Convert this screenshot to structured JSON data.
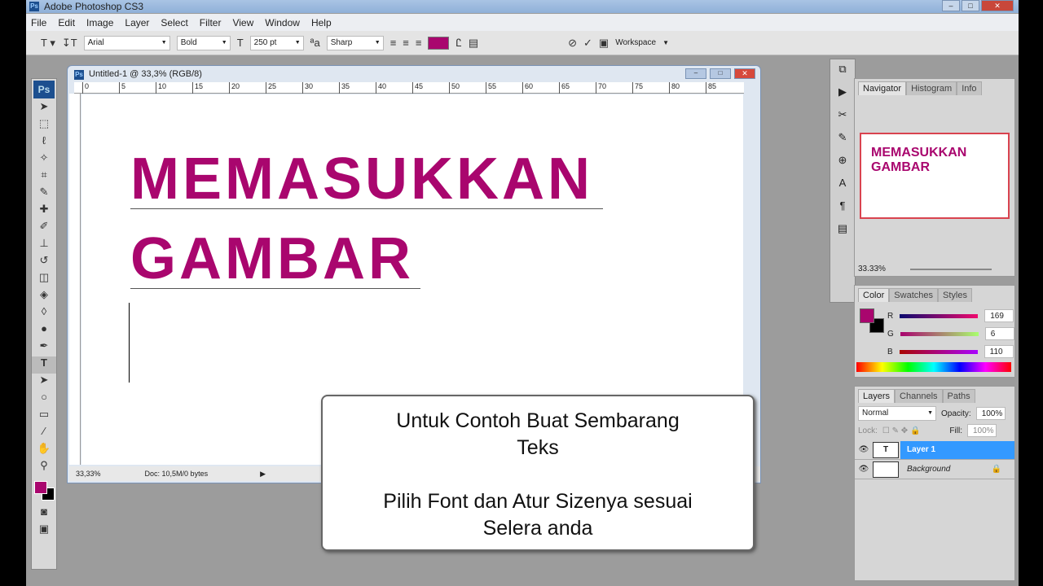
{
  "app": {
    "title": "Adobe Photoshop CS3"
  },
  "menu": [
    "File",
    "Edit",
    "Image",
    "Layer",
    "Select",
    "Filter",
    "View",
    "Window",
    "Help"
  ],
  "options": {
    "font_family": "Arial",
    "font_style": "Bold",
    "font_size": "250 pt",
    "antialias": "Sharp",
    "text_color": "#a9066e",
    "workspace": "Workspace"
  },
  "document": {
    "title": "Untitled-1 @ 33,3% (RGB/8)",
    "ruler_ticks": [
      "0",
      "5",
      "10",
      "15",
      "20",
      "25",
      "30",
      "35",
      "40",
      "45",
      "50",
      "55",
      "60",
      "65",
      "70",
      "75",
      "80",
      "85"
    ],
    "text_line1": "MEMASUKKAN",
    "text_line2": "GAMBAR",
    "zoom": "33,33%",
    "doc_info": "Doc: 10,5M/0 bytes"
  },
  "caption": {
    "line1": "Untuk Contoh Buat Sembarang Teks",
    "line2": "Pilih Font dan Atur Sizenya sesuai Selera anda"
  },
  "navigator": {
    "tabs": [
      "Navigator",
      "Histogram",
      "Info"
    ],
    "preview_text": "MEMASUKKAN GAMBAR",
    "zoom": "33.33%"
  },
  "color": {
    "tabs": [
      "Color",
      "Swatches",
      "Styles"
    ],
    "r_label": "R",
    "g_label": "G",
    "b_label": "B",
    "r": "169",
    "g": "6",
    "b": "110",
    "foreground": "#a9066e",
    "background": "#000000"
  },
  "layers": {
    "tabs": [
      "Layers",
      "Channels",
      "Paths"
    ],
    "blend_mode": "Normal",
    "opacity_label": "Opacity:",
    "opacity": "100%",
    "lock_label": "Lock:",
    "fill_label": "Fill:",
    "fill": "100%",
    "items": [
      {
        "name": "Layer 1",
        "selected": true
      },
      {
        "name": "Background",
        "locked": true
      }
    ]
  }
}
